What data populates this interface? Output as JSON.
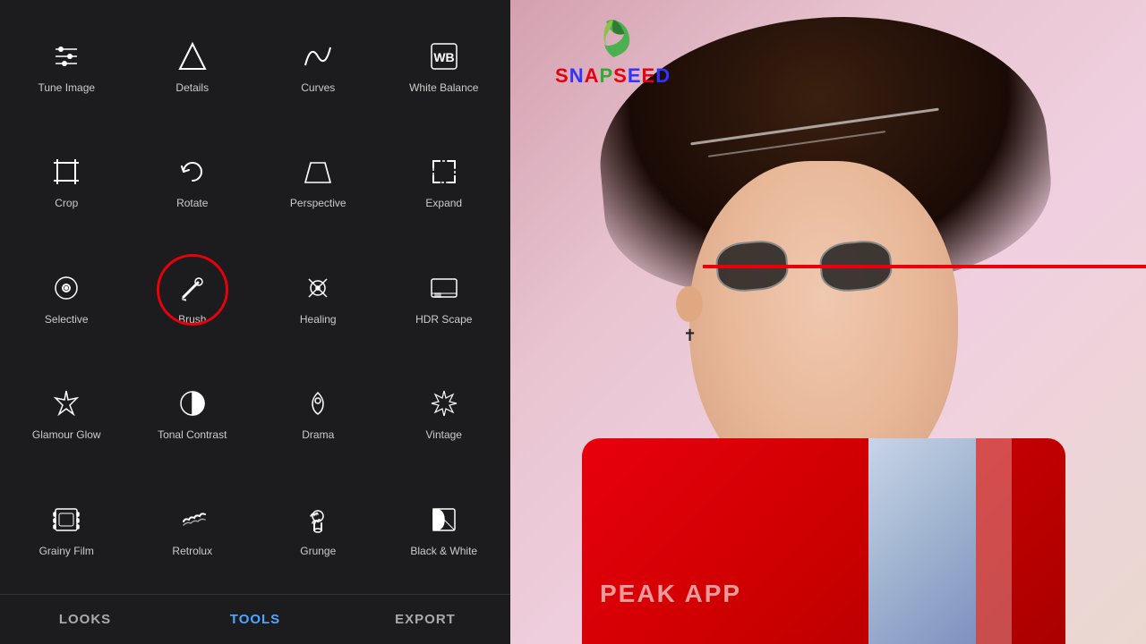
{
  "leftPanel": {
    "tools": [
      {
        "id": "tune-image",
        "label": "Tune Image",
        "icon": "sliders"
      },
      {
        "id": "details",
        "label": "Details",
        "icon": "triangle-down"
      },
      {
        "id": "curves",
        "label": "Curves",
        "icon": "curves"
      },
      {
        "id": "white-balance",
        "label": "White Balance",
        "icon": "wb"
      },
      {
        "id": "crop",
        "label": "Crop",
        "icon": "crop"
      },
      {
        "id": "rotate",
        "label": "Rotate",
        "icon": "rotate"
      },
      {
        "id": "perspective",
        "label": "Perspective",
        "icon": "perspective"
      },
      {
        "id": "expand",
        "label": "Expand",
        "icon": "expand"
      },
      {
        "id": "selective",
        "label": "Selective",
        "icon": "selective"
      },
      {
        "id": "brush",
        "label": "Brush",
        "icon": "brush",
        "highlighted": true
      },
      {
        "id": "healing",
        "label": "Healing",
        "icon": "healing"
      },
      {
        "id": "hdr-scape",
        "label": "HDR Scape",
        "icon": "hdr"
      },
      {
        "id": "glamour-glow",
        "label": "Glamour Glow",
        "icon": "glamour"
      },
      {
        "id": "tonal-contrast",
        "label": "Tonal Contrast",
        "icon": "tonal"
      },
      {
        "id": "drama",
        "label": "Drama",
        "icon": "drama"
      },
      {
        "id": "vintage",
        "label": "Vintage",
        "icon": "vintage"
      },
      {
        "id": "grainy-film",
        "label": "Grainy Film",
        "icon": "film"
      },
      {
        "id": "retrolux",
        "label": "Retrolux",
        "icon": "retrolux"
      },
      {
        "id": "grunge",
        "label": "Grunge",
        "icon": "grunge"
      },
      {
        "id": "black-white",
        "label": "Black & White",
        "icon": "bw"
      }
    ]
  },
  "bottomTabs": [
    {
      "id": "looks",
      "label": "LOOKS",
      "active": false
    },
    {
      "id": "tools",
      "label": "TOOLS",
      "active": true
    },
    {
      "id": "export",
      "label": "EXPORT",
      "active": false
    }
  ],
  "snapseed": {
    "name": "SNAPSEED",
    "logoAlt": "Snapseed leaf logo"
  },
  "shirtText": "PEAK APP"
}
